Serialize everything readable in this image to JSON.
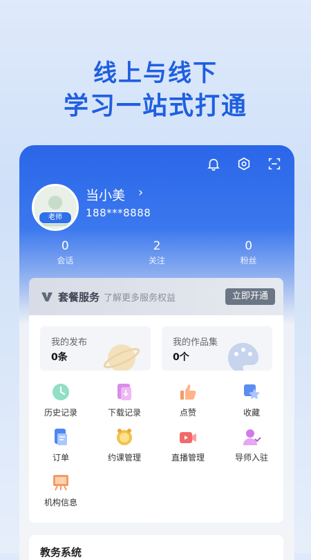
{
  "promo": {
    "line1": "线上与线下",
    "line2": "学习一站式打通"
  },
  "header": {
    "icons": [
      "bell-icon",
      "settings-icon",
      "scan-icon"
    ],
    "user": {
      "name": "当小美",
      "phone": "188***8888",
      "role_badge": "老师"
    },
    "stats": [
      {
        "value": "0",
        "label": "会话"
      },
      {
        "value": "2",
        "label": "关注"
      },
      {
        "value": "0",
        "label": "粉丝"
      }
    ]
  },
  "package": {
    "title": "套餐服务",
    "subtitle": "了解更多服务权益",
    "button": "立即开通"
  },
  "tiles": [
    {
      "title": "我的发布",
      "count": "0条"
    },
    {
      "title": "我的作品集",
      "count": "0个"
    }
  ],
  "grid": [
    {
      "label": "历史记录",
      "icon": "history-icon"
    },
    {
      "label": "下载记录",
      "icon": "download-icon"
    },
    {
      "label": "点赞",
      "icon": "like-icon"
    },
    {
      "label": "收藏",
      "icon": "favorite-icon"
    },
    {
      "label": "订单",
      "icon": "order-icon"
    },
    {
      "label": "约课管理",
      "icon": "schedule-icon"
    },
    {
      "label": "直播管理",
      "icon": "live-icon"
    },
    {
      "label": "导师入驻",
      "icon": "mentor-icon"
    },
    {
      "label": "机构信息",
      "icon": "institution-icon"
    }
  ],
  "next_section": {
    "title": "教务系统"
  },
  "colors": {
    "accent": "#2a66e8",
    "promo_text": "#1f5fe0",
    "package_button": "#6b7684"
  }
}
